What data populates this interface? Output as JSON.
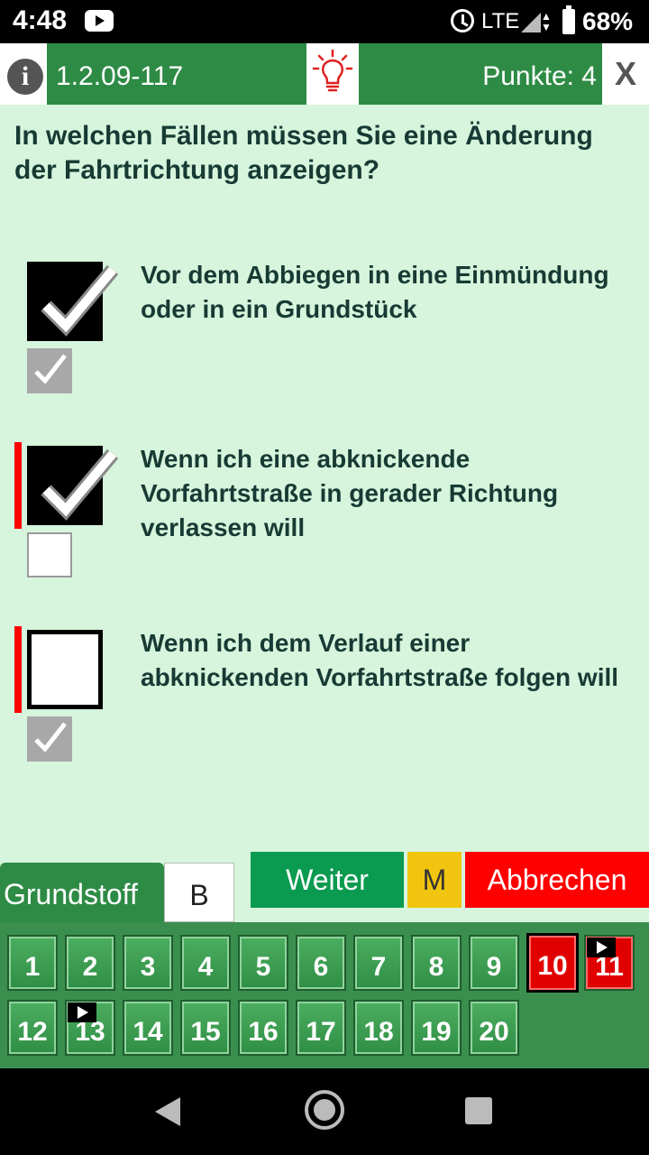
{
  "status_bar": {
    "time": "4:48",
    "network": "LTE",
    "battery": "68%"
  },
  "header": {
    "question_code": "1.2.09-117",
    "points": "Punkte: 4",
    "close_label": "X",
    "info_label": "i"
  },
  "question": {
    "text": "In welchen Fällen müssen Sie eine Änderung der Fahrtrichtung anzeigen?"
  },
  "answers": [
    {
      "text": "Vor dem Abbiegen in eine Einmündung oder in ein Grundstück",
      "user_checked": true,
      "correct": true,
      "marked_wrong": false
    },
    {
      "text": "Wenn ich eine abknickende Vorfahrtstraße in gerader Richtung verlassen will",
      "user_checked": true,
      "correct": false,
      "marked_wrong": true
    },
    {
      "text": "Wenn ich dem Verlauf einer abknickenden Vorfahrtstraße folgen will",
      "user_checked": false,
      "correct": true,
      "marked_wrong": true
    }
  ],
  "tabs": {
    "grundstoff": "Grundstoff",
    "class": "B"
  },
  "buttons": {
    "next": "Weiter",
    "mark": "M",
    "cancel": "Abbrechen"
  },
  "question_numbers": {
    "row1": [
      "1",
      "2",
      "3",
      "4",
      "5",
      "6",
      "7",
      "8",
      "9",
      "10",
      "11"
    ],
    "row2": [
      "12",
      "13",
      "14",
      "15",
      "16",
      "17",
      "18",
      "19",
      "20"
    ],
    "current": "10",
    "wrong": [
      "10",
      "11"
    ],
    "flagged": [
      "11",
      "13"
    ]
  },
  "colors": {
    "green": "#2e8b45",
    "background": "#d6f5dc",
    "red": "#ff0000",
    "yellow": "#f1c40f"
  },
  "icons": [
    "info-icon",
    "lightbulb-icon",
    "close-icon",
    "checkmark-icon",
    "flag-icon",
    "nav-back-icon",
    "nav-home-icon",
    "nav-recent-icon"
  ]
}
